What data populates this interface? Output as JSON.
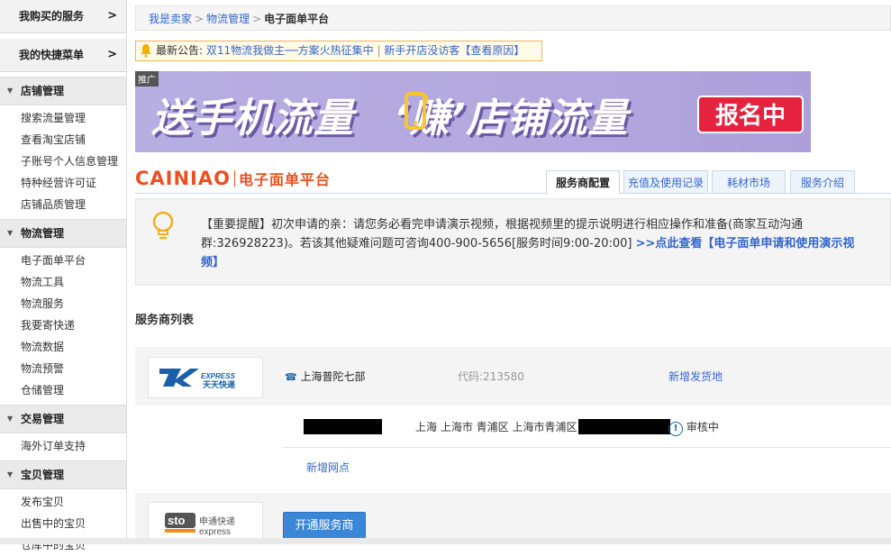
{
  "sidebar": {
    "top_links": [
      {
        "label": "我购买的服务",
        "chevron": ">"
      },
      {
        "label": "我的快捷菜单",
        "chevron": ">"
      }
    ],
    "sections": [
      {
        "title": "店铺管理",
        "items": [
          "搜索流量管理",
          "查看淘宝店铺",
          "子账号个人信息管理",
          "特种经营许可证",
          "店铺品质管理"
        ]
      },
      {
        "title": "物流管理",
        "items": [
          "电子面单平台",
          "物流工具",
          "物流服务",
          "我要寄快递",
          "物流数据",
          "物流预警",
          "仓储管理"
        ]
      },
      {
        "title": "交易管理",
        "items": [
          "海外订单支持"
        ]
      },
      {
        "title": "宝贝管理",
        "items": [
          "发布宝贝",
          "出售中的宝贝",
          "仓库中的宝贝"
        ]
      }
    ]
  },
  "breadcrumb": {
    "items": [
      "我是卖家",
      "物流管理"
    ],
    "sep": ">",
    "current": "电子面单平台"
  },
  "notice": {
    "prefix": "最新公告:",
    "link1": "双11物流我做主──方案火热征集中",
    "divider": "|",
    "link2": "新手开店没访客【查看原因】"
  },
  "banner": {
    "tag": "推广",
    "slogan_left": "送手机流量",
    "slogan_right": "‘赚’店铺流量",
    "cta": "报名中"
  },
  "logo": {
    "brand": "CAINIAO",
    "subtitle": "电子面单平台"
  },
  "tabs": [
    "服务商配置",
    "充值及使用记录",
    "耗材市场",
    "服务介绍"
  ],
  "important": {
    "text": "【重要提醒】初次申请的亲：请您务必看完申请演示视频，根据视频里的提示说明进行相应操作和准备(商家互动沟通群:326928223)。若该其他疑难问题可咨询400-900-5656[服务时间9:00-20:00]",
    "link": ">>点此查看【电子面单申请和使用演示视频】"
  },
  "list_title": "服务商列表",
  "provider1": {
    "logo_top": "EXPRESS",
    "logo_bottom": "天天快递",
    "phone": "上海普陀七部",
    "code": "代码:213580",
    "add_shipping": "新增发货地",
    "address": "上海 上海市 青浦区 上海市青浦区",
    "status": "审核中",
    "add_site": "新增网点"
  },
  "provider2": {
    "logo_cn": "申通快递",
    "logo_en": "express",
    "logo_sto": "sto",
    "open_button": "开通服务商"
  },
  "colors": {
    "link": "#3366cc",
    "brand_orange": "#ea5021",
    "banner_purple": "#b2a8de",
    "cta_red": "#e5233f",
    "button_blue": "#3a87d8"
  }
}
